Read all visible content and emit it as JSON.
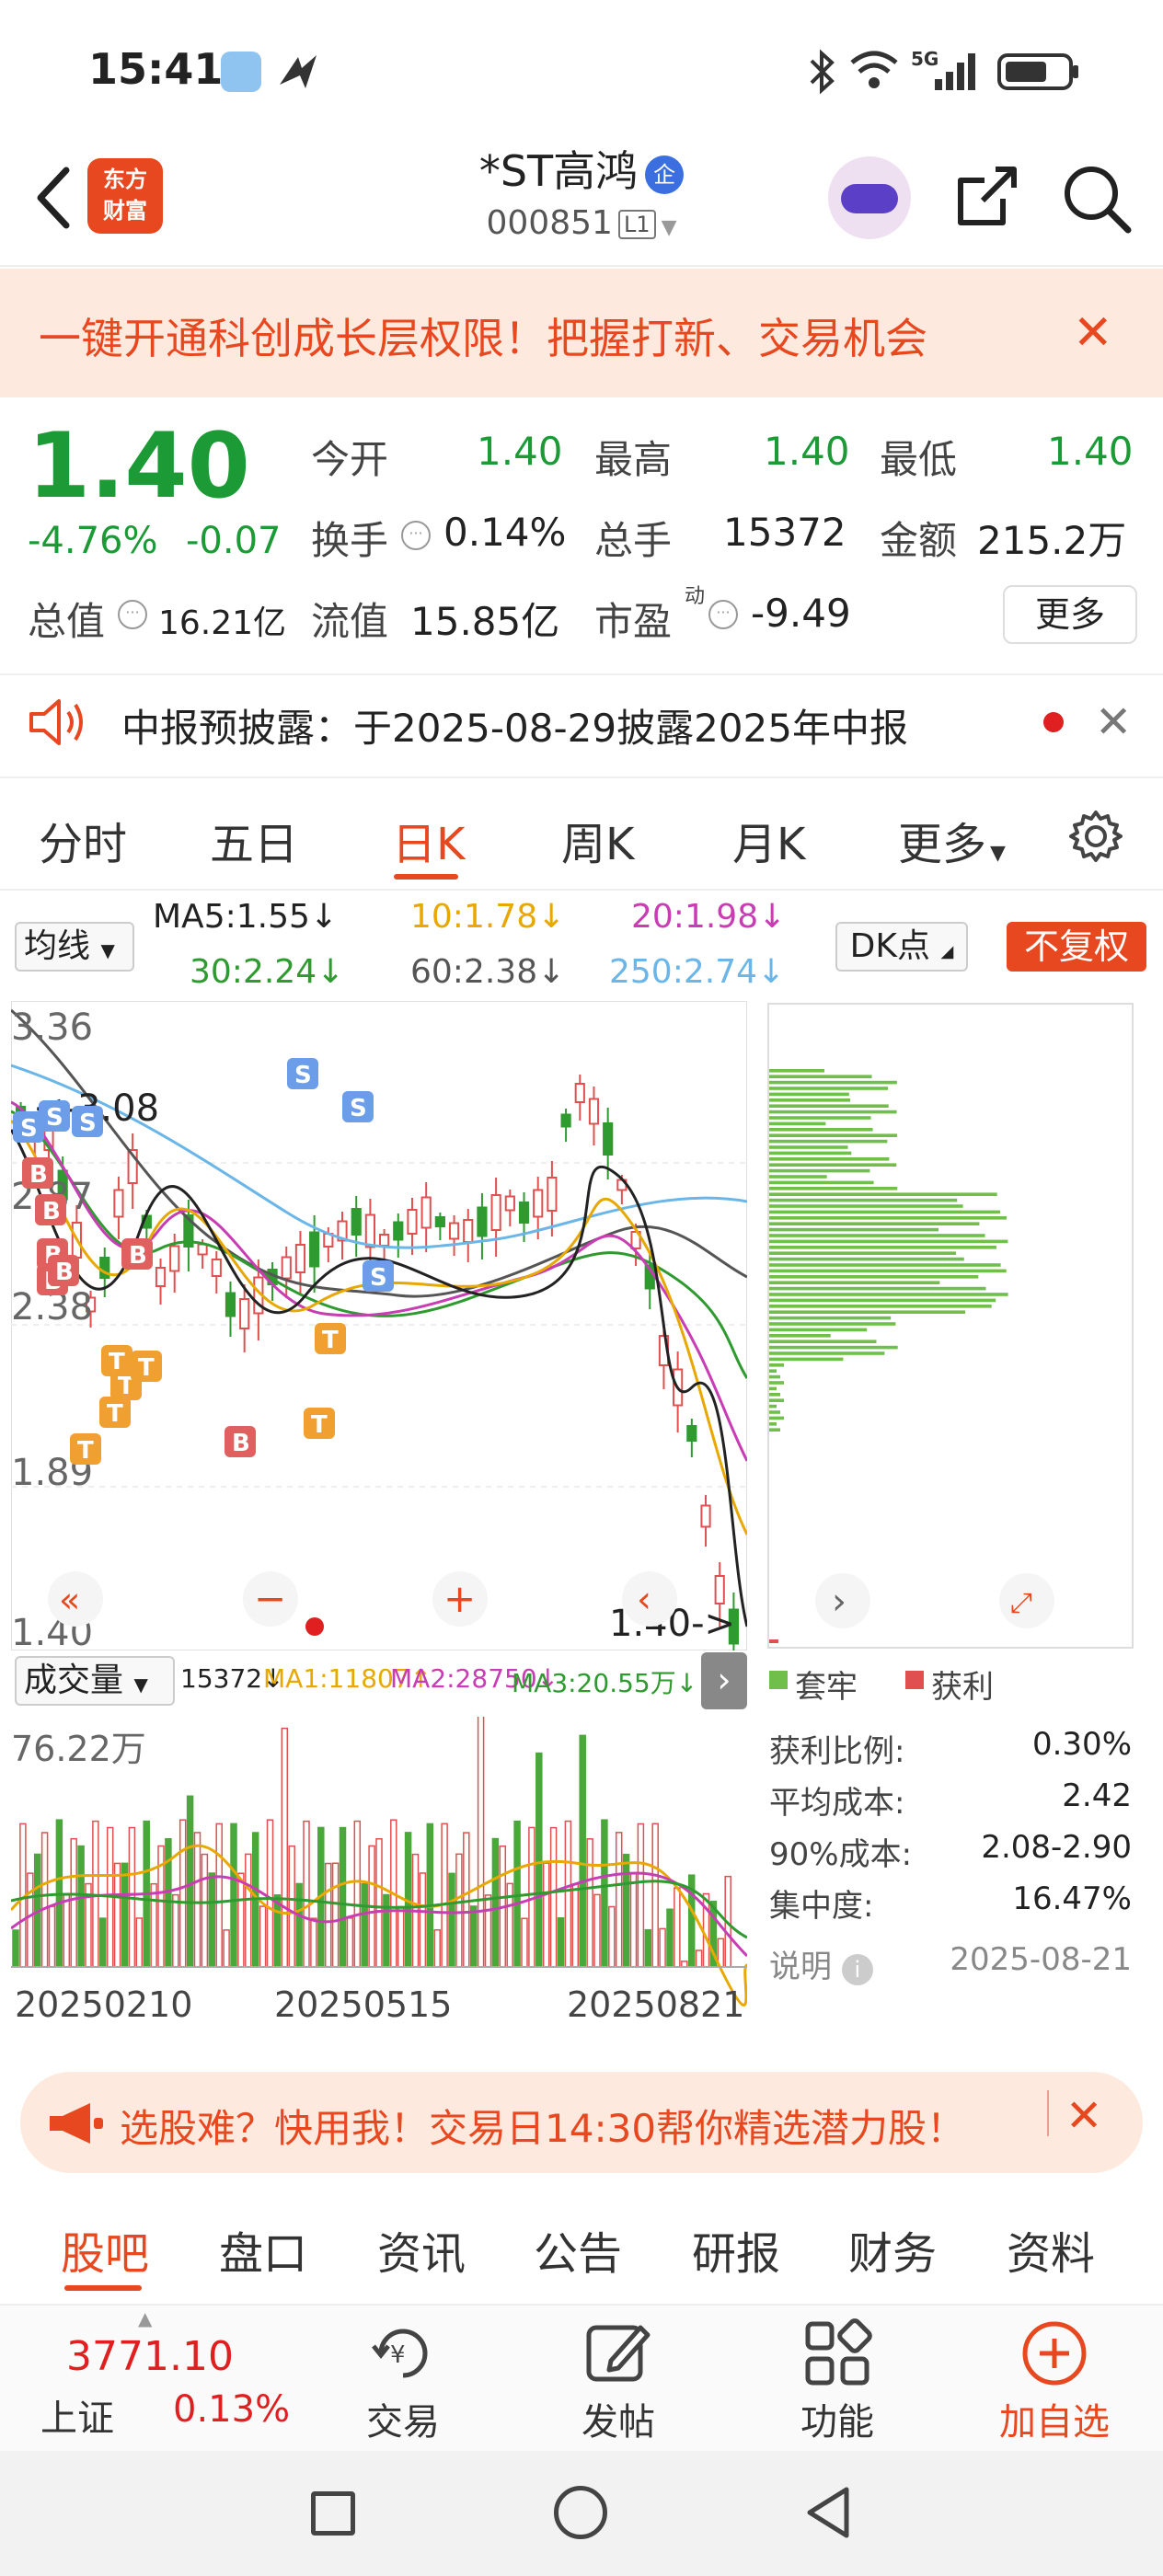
{
  "status_bar": {
    "time": "15:41",
    "network": "5G"
  },
  "header": {
    "logo_line1": "东方",
    "logo_line2": "财富",
    "stock_name": "*ST高鸿",
    "badge": "企",
    "stock_code": "000851",
    "level": "L1"
  },
  "promo_banner": {
    "text": "一键开通科创成长层权限！把握打新、交易机会"
  },
  "quote": {
    "price": "1.40",
    "change_pct": "-4.76%",
    "change": "-0.07",
    "open_label": "今开",
    "open": "1.40",
    "high_label": "最高",
    "high": "1.40",
    "low_label": "最低",
    "low": "1.40",
    "turnover_label": "换手",
    "turnover": "0.14%",
    "volume_label": "总手",
    "volume": "15372",
    "amount_label": "金额",
    "amount": "215.2万",
    "mktcap_label": "总值",
    "mktcap": "16.21亿",
    "float_label": "流值",
    "float_cap": "15.85亿",
    "pe_label": "市盈",
    "pe_sup": "动",
    "pe": "-9.49",
    "more": "更多"
  },
  "notice": {
    "text": "中报预披露：于2025-08-29披露2025年中报"
  },
  "tabs": [
    {
      "label": "分时"
    },
    {
      "label": "五日"
    },
    {
      "label": "日K"
    },
    {
      "label": "周K"
    },
    {
      "label": "月K"
    },
    {
      "label": "更多"
    }
  ],
  "ma_bar": {
    "selector": "均线",
    "ma5": "MA5:1.55",
    "ma10": "10:1.78",
    "ma20": "20:1.98",
    "ma30": "30:2.24",
    "ma60": "60:2.38",
    "ma250": "250:2.74",
    "dk": "DK点",
    "fuquan": "不复权"
  },
  "kline": {
    "y_labels": [
      "3.36",
      "2.87",
      "2.38",
      "1.89",
      "1.40"
    ],
    "max_label": "<-3.08",
    "min_label": "1.40->",
    "ma_colors": {
      "ma5": "#222222",
      "ma10": "#e8a800",
      "ma20": "#c83cb4",
      "ma30": "#2f9a2f",
      "ma60": "#555555",
      "ma250": "#6bb6e8"
    }
  },
  "chips": {
    "trapped_label": "套牢",
    "profit_label": "获利",
    "rows": [
      {
        "label": "获利比例:",
        "value": "0.30%"
      },
      {
        "label": "平均成本:",
        "value": "2.42"
      },
      {
        "label": "90%成本:",
        "value": "2.08-2.90"
      },
      {
        "label": "集中度:",
        "value": "16.47%"
      }
    ],
    "note_label": "说明",
    "date": "2025-08-21"
  },
  "volume_bar": {
    "selector": "成交量",
    "vol": "15372",
    "ma1": "MA1:11807",
    "ma2": "MA2:28750",
    "ma3": "MA3:20.55万",
    "max_label": "76.22万",
    "dates": [
      "20250210",
      "20250515",
      "20250821"
    ]
  },
  "ad": {
    "text": "选股难？快用我！交易日14:30帮你精选潜力股！"
  },
  "bottom_tabs": [
    {
      "label": "股吧"
    },
    {
      "label": "盘口"
    },
    {
      "label": "资讯"
    },
    {
      "label": "公告"
    },
    {
      "label": "研报"
    },
    {
      "label": "财务"
    },
    {
      "label": "资料"
    }
  ],
  "toolbar": {
    "index_value": "3771.10",
    "index_name": "上证",
    "index_pct": "0.13%",
    "trade": "交易",
    "post": "发帖",
    "functions": "功能",
    "add_watch": "加自选"
  }
}
